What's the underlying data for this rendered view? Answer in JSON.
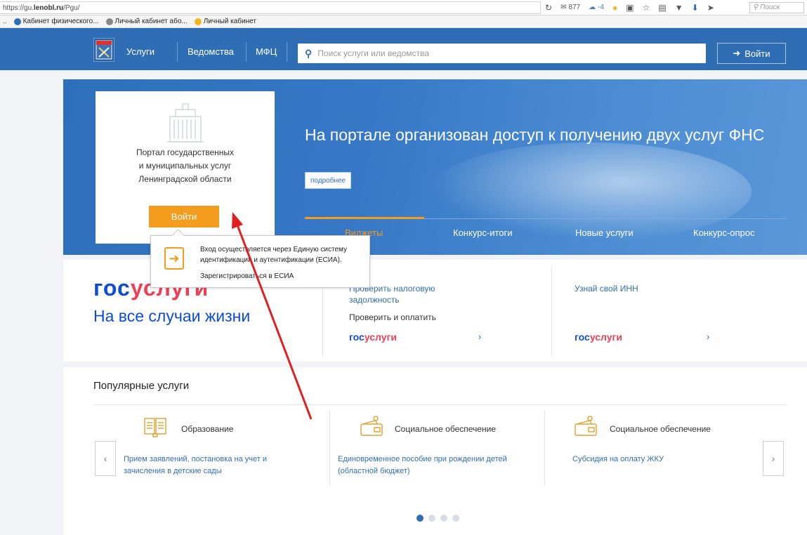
{
  "browser": {
    "url_prefix": "https://gu.",
    "url_domain": "lenobl.ru",
    "url_path": "/Pgu/",
    "mail_count": "877",
    "weather": "-4",
    "search_placeholder": "Поиск"
  },
  "bookmarks": [
    {
      "label": "Кабинет физического...",
      "icon": "tax-icon",
      "color": "#2f6eb5"
    },
    {
      "label": "Личный кабинет або...",
      "icon": "globe-icon",
      "color": "#777777"
    },
    {
      "label": "Личный кабинет",
      "icon": "service-icon",
      "color": "#f3b51e"
    }
  ],
  "nav": {
    "items": [
      "Услуги",
      "Ведомства",
      "МФЦ"
    ],
    "search_placeholder": "Поиск услуги или ведомства",
    "login_label": "Войти"
  },
  "hero": {
    "card_text_1": "Портал государственных",
    "card_text_2": "и муниципальных услуг",
    "card_text_3": "Ленинградской области",
    "card_login": "Войти",
    "title": "На портале организован доступ к получению двух услуг ФНС",
    "more_label": "подробнее",
    "tabs": [
      "Виджеты",
      "Конкурс-итоги",
      "Новые услуги",
      "Конкурс-опрос"
    ],
    "active_tab": 0
  },
  "tooltip": {
    "text": "Вход осуществляется через Единую систему идентификации и аутентификации (ЕСИА).",
    "link": "Зарегистрироваться в ЕСИА"
  },
  "promo": {
    "gos_blue": "гос",
    "gos_red": "услуги",
    "slogan": "На все случаи жизни",
    "col1_title": "Проверить налоговую задолжность",
    "col1_sub": "Проверить и оплатить",
    "col2_title": "Узнай свой ИНН",
    "small_blue": "гос",
    "small_red": "услуги",
    "chevron": "›"
  },
  "popular": {
    "title": "Популярные услуги",
    "items": [
      {
        "category": "Образование",
        "link": "Прием заявлений, постановка на учет и зачисления в детские сады",
        "icon": "book-icon"
      },
      {
        "category": "Социальное обеспечение",
        "link": "Единовременное пособие при рождении детей (областной бюджет)",
        "icon": "wallet-icon"
      },
      {
        "category": "Социальное обеспечение",
        "link": "Субсидия на оплату ЖКУ",
        "icon": "wallet-icon"
      }
    ],
    "prev": "‹",
    "next": "›",
    "dots_total": 4,
    "dots_active": 0
  },
  "colors": {
    "nav_blue": "#2f6eb5",
    "accent_orange": "#f39c1e",
    "gos_blue": "#0d4cd3",
    "gos_red": "#ee3f58",
    "annotation_red": "#e02020"
  }
}
